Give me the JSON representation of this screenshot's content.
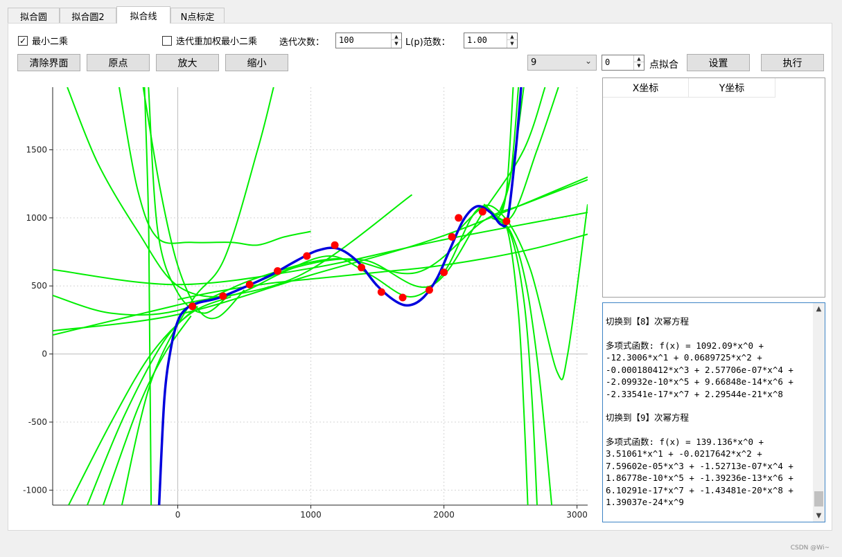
{
  "tabs": [
    "拟合圆",
    "拟合圆2",
    "拟合线",
    "N点标定"
  ],
  "active_tab": 2,
  "options": {
    "least_squares": {
      "label": "最小二乘",
      "checked": true
    },
    "irls": {
      "label": "迭代重加权最小二乘",
      "checked": false
    },
    "iterations_label": "迭代次数：",
    "iterations_value": "100",
    "lp_label": "L(p)范数：",
    "lp_value": "1.00"
  },
  "buttons": {
    "clear": "清除界面",
    "origin": "原点",
    "zoom_in": "放大",
    "zoom_out": "缩小",
    "settings": "设置",
    "execute": "执行"
  },
  "fit": {
    "degree_selected": "9",
    "point_count": "0",
    "point_fit_label": "点拟合"
  },
  "table": {
    "columns": [
      "X坐标",
      "Y坐标"
    ]
  },
  "log": {
    "lines": [
      "切换到【8】次幂方程",
      "",
      "多项式函数: f(x) = 1092.09*x^0 +",
      "-12.3006*x^1 + 0.0689725*x^2 +",
      "-0.000180412*x^3 + 2.57706e-07*x^4 +",
      "-2.09932e-10*x^5 + 9.66848e-14*x^6 +",
      "-2.33541e-17*x^7 + 2.29544e-21*x^8",
      "",
      "切换到【9】次幂方程",
      "",
      "多项式函数: f(x) = 139.136*x^0 +",
      "3.51061*x^1 + -0.0217642*x^2 +",
      "7.59602e-05*x^3 + -1.52713e-07*x^4 +",
      "1.86778e-10*x^5 + -1.39236e-13*x^6 +",
      "6.10291e-17*x^7 + -1.43481e-20*x^8 +",
      "1.39037e-24*x^9"
    ]
  },
  "chart_data": {
    "type": "scatter",
    "xlim": [
      -940,
      3080
    ],
    "ylim": [
      -1110,
      1960
    ],
    "x_ticks": [
      0,
      1000,
      2000,
      3000
    ],
    "y_ticks": [
      1500,
      1000,
      500,
      0,
      -500,
      -1000
    ],
    "x_tick_labels": [
      "0",
      "1000",
      "2000",
      "3000"
    ],
    "y_tick_labels": [
      "1500",
      "1000",
      "500",
      "0",
      "-500",
      "-1000"
    ],
    "grid": true,
    "points_color": "#ff0000",
    "fit_color": "#0000dd",
    "candidate_color": "#00ee00",
    "points": [
      {
        "x": 110,
        "y": 350
      },
      {
        "x": 340,
        "y": 425
      },
      {
        "x": 540,
        "y": 510
      },
      {
        "x": 750,
        "y": 610
      },
      {
        "x": 970,
        "y": 720
      },
      {
        "x": 1180,
        "y": 800
      },
      {
        "x": 1380,
        "y": 635
      },
      {
        "x": 1530,
        "y": 455
      },
      {
        "x": 1690,
        "y": 415
      },
      {
        "x": 1890,
        "y": 470
      },
      {
        "x": 2000,
        "y": 600
      },
      {
        "x": 2060,
        "y": 860
      },
      {
        "x": 2110,
        "y": 1000
      },
      {
        "x": 2290,
        "y": 1045
      },
      {
        "x": 2470,
        "y": 975
      }
    ],
    "fit_curve": [
      {
        "x": -140,
        "y": -1110
      },
      {
        "x": -100,
        "y": -320
      },
      {
        "x": -50,
        "y": 50
      },
      {
        "x": 0,
        "y": 240
      },
      {
        "x": 60,
        "y": 330
      },
      {
        "x": 150,
        "y": 375
      },
      {
        "x": 300,
        "y": 410
      },
      {
        "x": 500,
        "y": 490
      },
      {
        "x": 700,
        "y": 580
      },
      {
        "x": 900,
        "y": 690
      },
      {
        "x": 1050,
        "y": 760
      },
      {
        "x": 1200,
        "y": 775
      },
      {
        "x": 1350,
        "y": 680
      },
      {
        "x": 1500,
        "y": 500
      },
      {
        "x": 1650,
        "y": 380
      },
      {
        "x": 1750,
        "y": 360
      },
      {
        "x": 1850,
        "y": 420
      },
      {
        "x": 1950,
        "y": 560
      },
      {
        "x": 2050,
        "y": 780
      },
      {
        "x": 2150,
        "y": 990
      },
      {
        "x": 2250,
        "y": 1085
      },
      {
        "x": 2350,
        "y": 1040
      },
      {
        "x": 2430,
        "y": 950
      },
      {
        "x": 2480,
        "y": 1000
      },
      {
        "x": 2540,
        "y": 1500
      },
      {
        "x": 2580,
        "y": 1960
      }
    ],
    "candidate_curves": [
      [
        {
          "x": -940,
          "y": 620
        },
        {
          "x": 0,
          "y": 510
        },
        {
          "x": 1000,
          "y": 630
        },
        {
          "x": 2000,
          "y": 840
        },
        {
          "x": 3080,
          "y": 1040
        }
      ],
      [
        {
          "x": -940,
          "y": 170
        },
        {
          "x": 0,
          "y": 290
        },
        {
          "x": 1000,
          "y": 580
        },
        {
          "x": 2000,
          "y": 870
        },
        {
          "x": 3080,
          "y": 1300
        }
      ],
      [
        {
          "x": -940,
          "y": 140
        },
        {
          "x": 0,
          "y": 360
        },
        {
          "x": 900,
          "y": 570
        },
        {
          "x": 1760,
          "y": 1170
        }
      ],
      [
        {
          "x": -940,
          "y": 430
        },
        {
          "x": -500,
          "y": 300
        },
        {
          "x": 0,
          "y": 320
        },
        {
          "x": 600,
          "y": 560
        },
        {
          "x": 1200,
          "y": 700
        },
        {
          "x": 1800,
          "y": 600
        },
        {
          "x": 2300,
          "y": 980
        },
        {
          "x": 2600,
          "y": 1100
        },
        {
          "x": 3080,
          "y": 1280
        }
      ],
      [
        {
          "x": -830,
          "y": 1960
        },
        {
          "x": -600,
          "y": 1400
        },
        {
          "x": -300,
          "y": 900
        },
        {
          "x": 0,
          "y": 500
        },
        {
          "x": 400,
          "y": 430
        },
        {
          "x": 900,
          "y": 640
        },
        {
          "x": 1400,
          "y": 690
        },
        {
          "x": 1900,
          "y": 500
        },
        {
          "x": 2300,
          "y": 1050
        },
        {
          "x": 2600,
          "y": 1500
        },
        {
          "x": 2760,
          "y": 1960
        }
      ],
      [
        {
          "x": -440,
          "y": 1960
        },
        {
          "x": -300,
          "y": 1200
        },
        {
          "x": -150,
          "y": 850
        },
        {
          "x": 100,
          "y": 820
        },
        {
          "x": 400,
          "y": 820
        },
        {
          "x": 600,
          "y": 800
        },
        {
          "x": 800,
          "y": 860
        },
        {
          "x": 1000,
          "y": 900
        }
      ],
      [
        {
          "x": 720,
          "y": 1960
        },
        {
          "x": 600,
          "y": 1500
        },
        {
          "x": 350,
          "y": 700
        },
        {
          "x": 100,
          "y": 380
        },
        {
          "x": -200,
          "y": -200
        },
        {
          "x": -420,
          "y": -1110
        }
      ],
      [
        {
          "x": -250,
          "y": 1960
        },
        {
          "x": -220,
          "y": 1000
        },
        {
          "x": -210,
          "y": 0
        },
        {
          "x": -200,
          "y": -1110
        }
      ],
      [
        {
          "x": -260,
          "y": 1960
        },
        {
          "x": -130,
          "y": 1200
        },
        {
          "x": 0,
          "y": 650
        },
        {
          "x": 150,
          "y": 330
        },
        {
          "x": 300,
          "y": 270
        },
        {
          "x": 500,
          "y": 470
        }
      ],
      [
        {
          "x": -220,
          "y": 1960
        },
        {
          "x": -150,
          "y": 900
        },
        {
          "x": 0,
          "y": 450
        },
        {
          "x": 200,
          "y": 300
        },
        {
          "x": 400,
          "y": 450
        }
      ],
      [
        {
          "x": -820,
          "y": -1110
        },
        {
          "x": -500,
          "y": -500
        },
        {
          "x": -200,
          "y": 0
        },
        {
          "x": 100,
          "y": 300
        },
        {
          "x": 400,
          "y": 420
        }
      ],
      [
        {
          "x": -680,
          "y": -1110
        },
        {
          "x": -400,
          "y": -450
        },
        {
          "x": -100,
          "y": 100
        },
        {
          "x": 150,
          "y": 350
        }
      ],
      [
        {
          "x": -560,
          "y": -1110
        },
        {
          "x": -300,
          "y": -400
        },
        {
          "x": -100,
          "y": 0
        },
        {
          "x": 100,
          "y": 280
        }
      ],
      [
        {
          "x": 0,
          "y": 400
        },
        {
          "x": 300,
          "y": 460
        },
        {
          "x": 700,
          "y": 520
        },
        {
          "x": 1100,
          "y": 560
        },
        {
          "x": 1500,
          "y": 600
        },
        {
          "x": 1900,
          "y": 640
        },
        {
          "x": 2300,
          "y": 700
        },
        {
          "x": 2700,
          "y": 780
        },
        {
          "x": 3080,
          "y": 880
        }
      ],
      [
        {
          "x": 100,
          "y": 360
        },
        {
          "x": 400,
          "y": 450
        },
        {
          "x": 800,
          "y": 610
        },
        {
          "x": 1150,
          "y": 720
        },
        {
          "x": 1450,
          "y": 580
        },
        {
          "x": 1750,
          "y": 420
        },
        {
          "x": 2000,
          "y": 600
        },
        {
          "x": 2250,
          "y": 1060
        },
        {
          "x": 2450,
          "y": 1010
        },
        {
          "x": 2650,
          "y": 620
        },
        {
          "x": 2850,
          "y": -130
        },
        {
          "x": 2930,
          "y": 0
        },
        {
          "x": 3080,
          "y": 1100
        }
      ],
      [
        {
          "x": 2360,
          "y": 1000
        },
        {
          "x": 2500,
          "y": 900
        },
        {
          "x": 2620,
          "y": 500
        },
        {
          "x": 2720,
          "y": -200
        },
        {
          "x": 2810,
          "y": -1110
        }
      ],
      [
        {
          "x": 2370,
          "y": 1000
        },
        {
          "x": 2500,
          "y": 880
        },
        {
          "x": 2600,
          "y": 400
        },
        {
          "x": 2660,
          "y": -300
        },
        {
          "x": 2700,
          "y": -1110
        }
      ],
      [
        {
          "x": 2380,
          "y": 1000
        },
        {
          "x": 2480,
          "y": 900
        },
        {
          "x": 2560,
          "y": 300
        },
        {
          "x": 2600,
          "y": -400
        },
        {
          "x": 2630,
          "y": -1110
        }
      ],
      [
        {
          "x": 2520,
          "y": 1960
        },
        {
          "x": 2470,
          "y": 1200
        },
        {
          "x": 2400,
          "y": 1000
        },
        {
          "x": 2300,
          "y": 1080
        },
        {
          "x": 2100,
          "y": 900
        }
      ],
      [
        {
          "x": 2560,
          "y": 1960
        },
        {
          "x": 2500,
          "y": 1300
        },
        {
          "x": 2420,
          "y": 1050
        }
      ],
      [
        {
          "x": 2600,
          "y": 1960
        },
        {
          "x": 2520,
          "y": 1400
        },
        {
          "x": 2430,
          "y": 1040
        }
      ],
      [
        {
          "x": 2860,
          "y": 1960
        },
        {
          "x": 2700,
          "y": 1500
        },
        {
          "x": 2500,
          "y": 1000
        },
        {
          "x": 2300,
          "y": 1100
        }
      ]
    ]
  }
}
